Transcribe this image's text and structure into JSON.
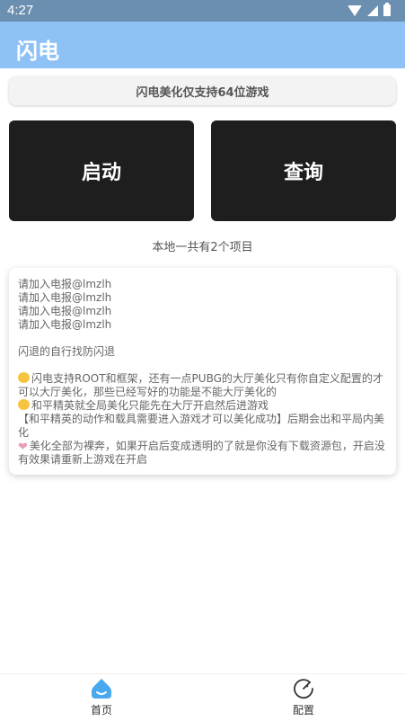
{
  "status_bar": {
    "time": "4:27"
  },
  "app_bar": {
    "title": "闪电"
  },
  "notice": {
    "text": "闪电美化仅支持64位游戏"
  },
  "buttons": {
    "start": "启动",
    "query": "查询"
  },
  "project_count": "本地一共有2个项目",
  "card": {
    "line1": "请加入电报@lmzlh",
    "line2": "请加入电报@lmzlh",
    "line3": "请加入电报@lmzlh",
    "line4": "请加入电报@lmzlh",
    "line5": "闪退的自行找防闪退",
    "line6": "闪电支持ROOT和框架，还有一点PUBG的大厅美化只有你自定义配置的才可以大厅美化，那些已经写好的功能是不能大厅美化的",
    "line7": "和平精英就全局美化只能先在大厅开启然后进游戏",
    "line8": "【和平精英的动作和载具需要进入游戏才可以美化成功】后期会出和平局内美化",
    "line9": "美化全部为裸奔，如果开启后变成透明的了就是你没有下载资源包，开启没有效果请重新上游戏在开启"
  },
  "bottom_nav": {
    "home": "首页",
    "config": "配置"
  },
  "colors": {
    "status_bar": "#6b8fb0",
    "app_bar": "#8ec1f5",
    "button_bg": "#1e1e1e",
    "home_icon": "#4aa8ee"
  }
}
